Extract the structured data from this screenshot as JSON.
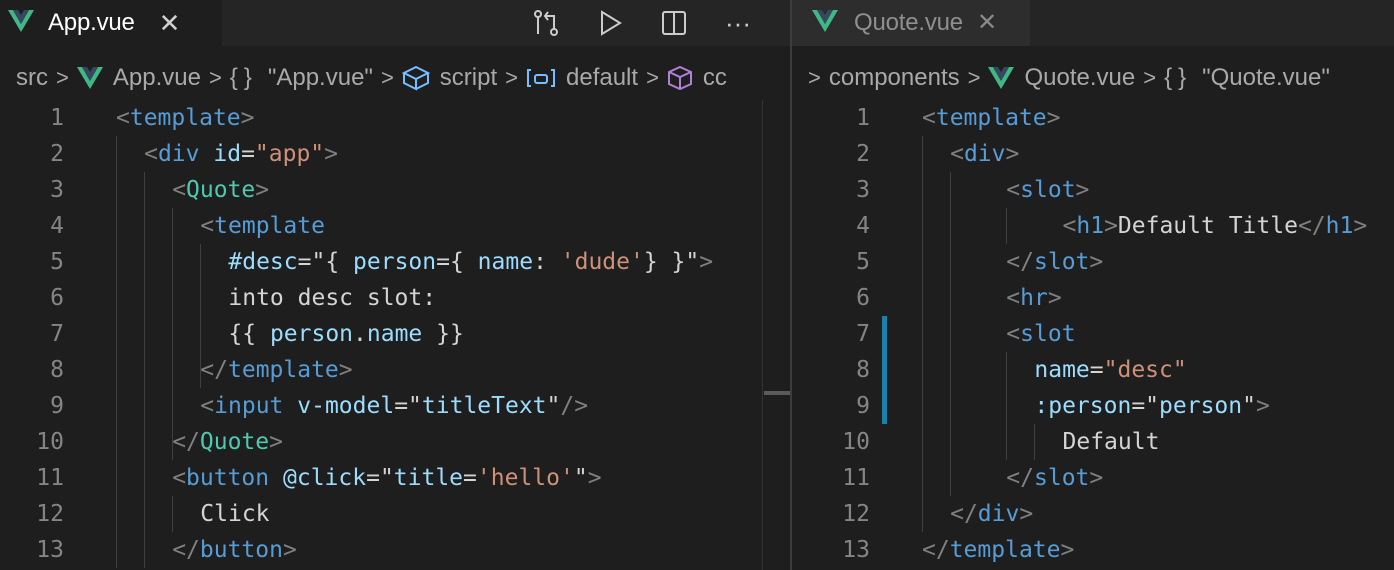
{
  "colors": {
    "background": "#1e1e1e",
    "tag": "#569cd6",
    "component": "#4ec9b0",
    "attribute": "#9cdcfe",
    "string": "#ce9178",
    "bracket": "#808080",
    "vue_green": "#41b883",
    "modified_gutter": "#1b81a8"
  },
  "left_editor": {
    "tab": {
      "label": "App.vue",
      "icon": "vue-icon",
      "close": "✕"
    },
    "actions": [
      "compare-changes-icon",
      "run-icon",
      "split-editor-icon",
      "more-actions-icon"
    ],
    "actions_more_glyph": "···",
    "breadcrumb": {
      "src": "src",
      "file": "App.vue",
      "braces": "{}",
      "module": "\"App.vue\"",
      "script": "script",
      "default": "default",
      "cc": "cc",
      "sep": ">"
    },
    "line_numbers": [
      "1",
      "2",
      "3",
      "4",
      "5",
      "6",
      "7",
      "8",
      "9",
      "10",
      "11",
      "12",
      "13"
    ]
  },
  "right_editor": {
    "tab": {
      "label": "Quote.vue",
      "icon": "vue-icon",
      "close": "✕"
    },
    "breadcrumb": {
      "components": "components",
      "file": "Quote.vue",
      "braces": "{}",
      "module": "\"Quote.vue\"",
      "sep": ">"
    },
    "line_numbers": [
      "1",
      "2",
      "3",
      "4",
      "5",
      "6",
      "7",
      "8",
      "9",
      "10",
      "11",
      "12",
      "13"
    ]
  },
  "code_left": [
    [
      [
        "br",
        "<"
      ],
      [
        "tag",
        "template"
      ],
      [
        "br",
        ">"
      ]
    ],
    [
      [
        "br",
        "<"
      ],
      [
        "tag",
        "div"
      ],
      [
        "txt",
        " "
      ],
      [
        "attr",
        "id"
      ],
      [
        "txt",
        "="
      ],
      [
        "str",
        "\"app\""
      ],
      [
        "br",
        ">"
      ]
    ],
    [
      [
        "br",
        "<"
      ],
      [
        "cmp",
        "Quote"
      ],
      [
        "br",
        ">"
      ]
    ],
    [
      [
        "br",
        "<"
      ],
      [
        "tag",
        "template"
      ]
    ],
    [
      [
        "attr",
        "#desc"
      ],
      [
        "txt",
        "=\"{ "
      ],
      [
        "attr",
        "person"
      ],
      [
        "txt",
        "={ "
      ],
      [
        "attr",
        "name"
      ],
      [
        "txt",
        ": "
      ],
      [
        "str",
        "'dude'"
      ],
      [
        "txt",
        "} }\""
      ],
      [
        "br",
        ">"
      ]
    ],
    [
      [
        "txt",
        "into desc slot:"
      ]
    ],
    [
      [
        "txt",
        "{{ "
      ],
      [
        "attr",
        "person"
      ],
      [
        "txt",
        "."
      ],
      [
        "attr",
        "name"
      ],
      [
        "txt",
        " }}"
      ]
    ],
    [
      [
        "br",
        "</"
      ],
      [
        "tag",
        "template"
      ],
      [
        "br",
        ">"
      ]
    ],
    [
      [
        "br",
        "<"
      ],
      [
        "tag",
        "input"
      ],
      [
        "txt",
        " "
      ],
      [
        "attr",
        "v-model"
      ],
      [
        "txt",
        "=\""
      ],
      [
        "attr",
        "titleText"
      ],
      [
        "txt",
        "\""
      ],
      [
        "br",
        "/>"
      ]
    ],
    [
      [
        "br",
        "</"
      ],
      [
        "cmp",
        "Quote"
      ],
      [
        "br",
        ">"
      ]
    ],
    [
      [
        "br",
        "<"
      ],
      [
        "tag",
        "button"
      ],
      [
        "txt",
        " "
      ],
      [
        "attr",
        "@click"
      ],
      [
        "txt",
        "=\""
      ],
      [
        "attr",
        "title"
      ],
      [
        "txt",
        "="
      ],
      [
        "str",
        "'hello'"
      ],
      [
        "txt",
        "\""
      ],
      [
        "br",
        ">"
      ]
    ],
    [
      [
        "txt",
        "Click"
      ]
    ],
    [
      [
        "br",
        "</"
      ],
      [
        "tag",
        "button"
      ],
      [
        "br",
        ">"
      ]
    ]
  ],
  "code_right": [
    [
      [
        "br",
        "<"
      ],
      [
        "tag",
        "template"
      ],
      [
        "br",
        ">"
      ]
    ],
    [
      [
        "br",
        "<"
      ],
      [
        "tag",
        "div"
      ],
      [
        "br",
        ">"
      ]
    ],
    [
      [
        "br",
        "<"
      ],
      [
        "tag",
        "slot"
      ],
      [
        "br",
        ">"
      ]
    ],
    [
      [
        "br",
        "<"
      ],
      [
        "tag",
        "h1"
      ],
      [
        "br",
        ">"
      ],
      [
        "txt",
        "Default Title"
      ],
      [
        "br",
        "</"
      ],
      [
        "tag",
        "h1"
      ],
      [
        "br",
        ">"
      ]
    ],
    [
      [
        "br",
        "</"
      ],
      [
        "tag",
        "slot"
      ],
      [
        "br",
        ">"
      ]
    ],
    [
      [
        "br",
        "<"
      ],
      [
        "tag",
        "hr"
      ],
      [
        "br",
        ">"
      ]
    ],
    [
      [
        "br",
        "<"
      ],
      [
        "tag",
        "slot"
      ]
    ],
    [
      [
        "attr",
        "name"
      ],
      [
        "txt",
        "="
      ],
      [
        "str",
        "\"desc\""
      ]
    ],
    [
      [
        "attr",
        ":person"
      ],
      [
        "txt",
        "=\""
      ],
      [
        "attr",
        "person"
      ],
      [
        "txt",
        "\""
      ],
      [
        "br",
        ">"
      ]
    ],
    [
      [
        "txt",
        "Default"
      ]
    ],
    [
      [
        "br",
        "</"
      ],
      [
        "tag",
        "slot"
      ],
      [
        "br",
        ">"
      ]
    ],
    [
      [
        "br",
        "</"
      ],
      [
        "tag",
        "div"
      ],
      [
        "br",
        ">"
      ]
    ],
    [
      [
        "br",
        "</"
      ],
      [
        "tag",
        "template"
      ],
      [
        "br",
        ">"
      ]
    ]
  ]
}
